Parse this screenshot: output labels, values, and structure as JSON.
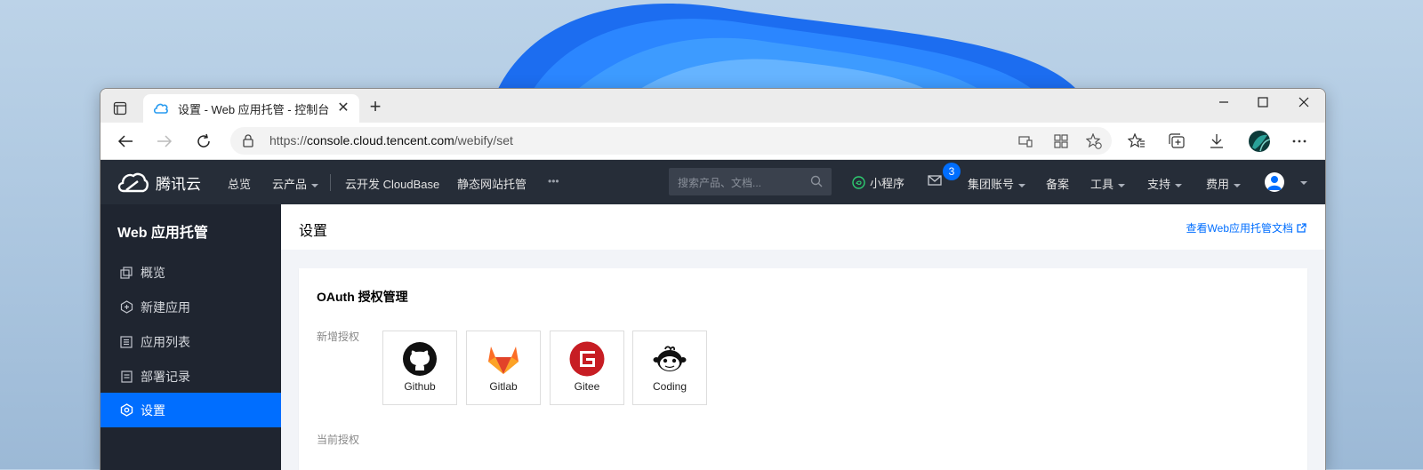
{
  "browser": {
    "tab_title": "设置 - Web 应用托管 - 控制台",
    "new_tab_icon": "plus-icon",
    "url_host_prefix": "https://",
    "url_host": "console.cloud.tencent.com",
    "url_path": "/webify/set"
  },
  "header": {
    "brand": "腾讯云",
    "nav": {
      "overview": "总览",
      "products": "云产品",
      "cloudbase": "云开发 CloudBase",
      "static_hosting": "静态网站托管",
      "more": "•••"
    },
    "search_placeholder": "搜索产品、文档...",
    "miniprogram": "小程序",
    "message_count": "3",
    "account": "集团账号",
    "beian": "备案",
    "tools": "工具",
    "support": "支持",
    "billing": "费用"
  },
  "sidebar": {
    "title": "Web 应用托管",
    "items": [
      {
        "label": "概览",
        "icon": "overview-icon"
      },
      {
        "label": "新建应用",
        "icon": "new-app-icon"
      },
      {
        "label": "应用列表",
        "icon": "app-list-icon"
      },
      {
        "label": "部署记录",
        "icon": "deploy-record-icon"
      },
      {
        "label": "设置",
        "icon": "settings-icon"
      }
    ]
  },
  "main": {
    "page_title": "设置",
    "doc_link": "查看Web应用托管文档",
    "oauth": {
      "title": "OAuth 授权管理",
      "new_label": "新增授权",
      "current_label": "当前授权",
      "providers": [
        {
          "label": "Github"
        },
        {
          "label": "Gitlab"
        },
        {
          "label": "Gitee"
        },
        {
          "label": "Coding"
        }
      ]
    }
  },
  "colors": {
    "accent": "#006eff",
    "header_bg": "#262d38",
    "sidebar_bg": "#1f2530"
  }
}
